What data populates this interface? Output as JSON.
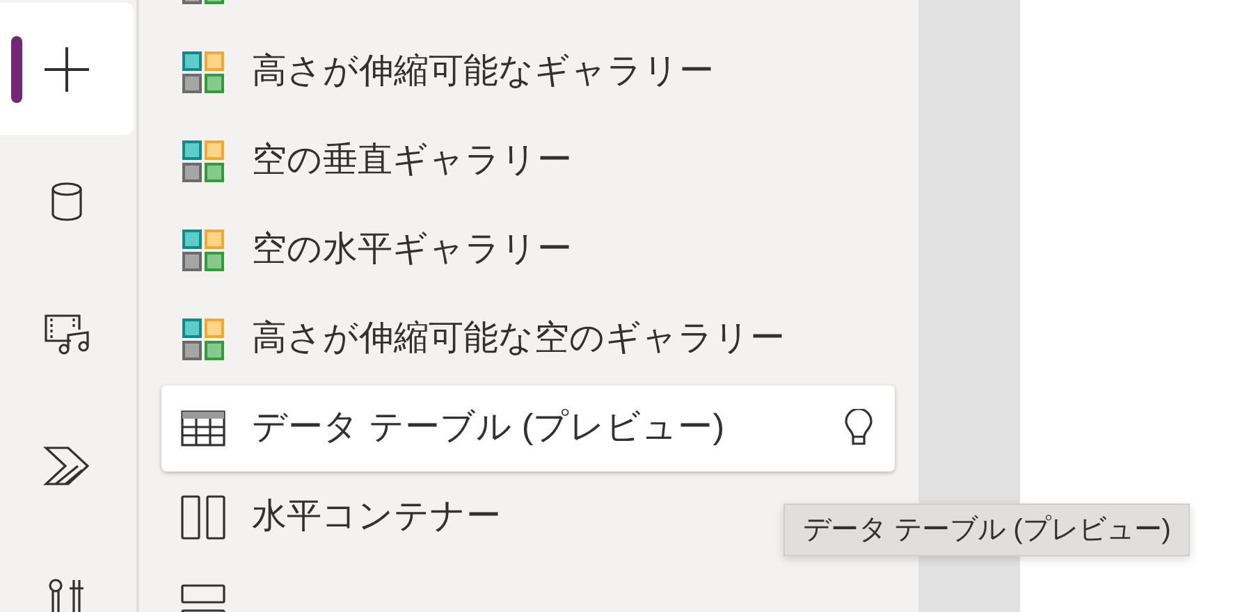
{
  "rail": [
    {
      "kind": "add",
      "selected": true
    },
    {
      "kind": "data",
      "selected": false
    },
    {
      "kind": "media",
      "selected": false
    },
    {
      "kind": "automate",
      "selected": false
    },
    {
      "kind": "tools",
      "selected": false
    }
  ],
  "items": [
    {
      "kind": "gallery",
      "selected": false
    },
    {
      "kind": "gallery",
      "label": "高さが伸縮可能なギャラリー",
      "selected": false
    },
    {
      "kind": "gallery",
      "label": "空の垂直ギャラリー",
      "selected": false
    },
    {
      "kind": "gallery",
      "label": "空の水平ギャラリー",
      "selected": false
    },
    {
      "kind": "gallery",
      "label": "高さが伸縮可能な空のギャラリー",
      "selected": false
    },
    {
      "kind": "table",
      "label": "データ テーブル (プレビュー)",
      "selected": true
    },
    {
      "kind": "hcontainer",
      "label": "水平コンテナー",
      "selected": false
    },
    {
      "kind": "vcontainer",
      "selected": false
    }
  ],
  "tooltip": "データ テーブル (プレビュー)"
}
